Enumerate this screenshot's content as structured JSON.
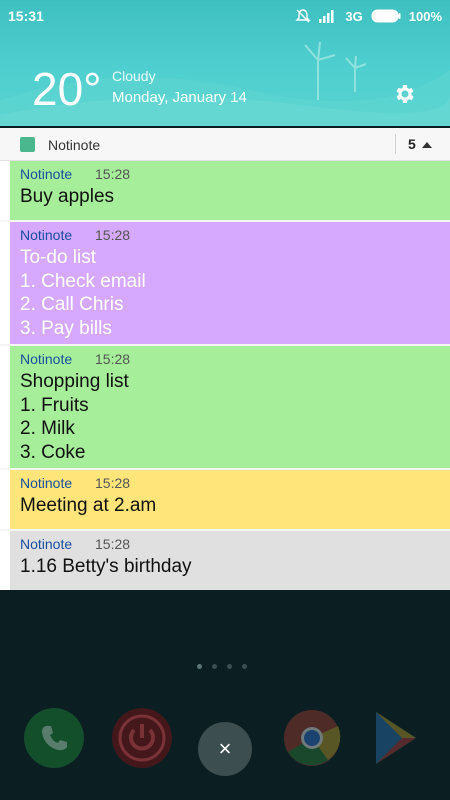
{
  "status_bar": {
    "time": "15:31",
    "network": "3G",
    "battery": "100%"
  },
  "weather": {
    "temperature": "20°",
    "condition": "Cloudy",
    "date": "Monday, January 14"
  },
  "notification_group": {
    "app_name": "Notinote",
    "count": "5"
  },
  "notifications": [
    {
      "app": "Notinote",
      "time": "15:28",
      "text": "Buy apples",
      "color": "#a6ee9a"
    },
    {
      "app": "Notinote",
      "time": "15:28",
      "text": "To-do list\n1. Check email\n2. Call Chris\n3. Pay bills",
      "color": "#d6a9ff"
    },
    {
      "app": "Notinote",
      "time": "15:28",
      "text": "Shopping list\n1. Fruits\n2. Milk\n3. Coke",
      "color": "#a6ee9a"
    },
    {
      "app": "Notinote",
      "time": "15:28",
      "text": "Meeting at 2.am",
      "color": "#ffe57a"
    },
    {
      "app": "Notinote",
      "time": "15:28",
      "text": "1.16 Betty's birthday",
      "color": "#e0e0e0"
    }
  ],
  "dock": {
    "close_label": "×"
  },
  "icons": [
    "mute-icon",
    "signal-icon",
    "battery-icon",
    "gear-icon",
    "app-icon",
    "chevron-up-icon",
    "phone-icon",
    "power-icon",
    "chrome-icon",
    "play-store-icon",
    "close-icon"
  ]
}
